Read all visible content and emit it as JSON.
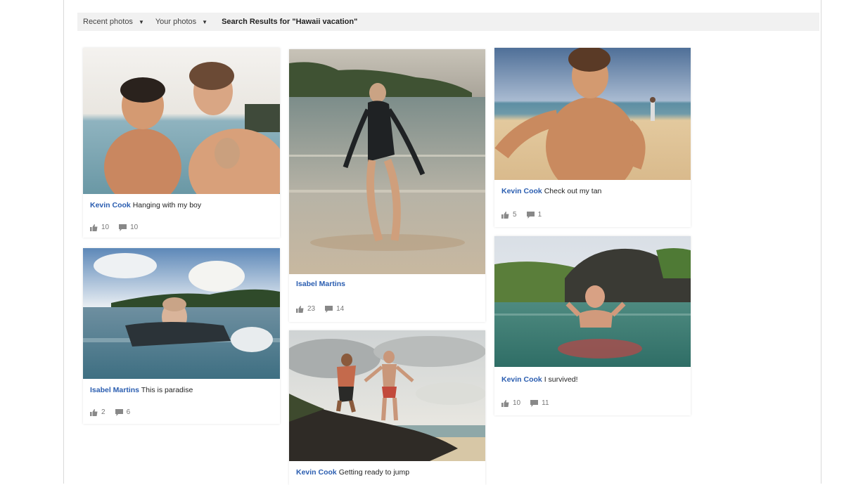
{
  "toolbar": {
    "recent_label": "Recent photos",
    "yours_label": "Your photos",
    "results_title": "Search Results for \"Hawaii vacation\""
  },
  "colors": {
    "author": "#2a5db0",
    "toolbar_bg": "#f1f1f1",
    "stat": "#777777"
  },
  "cards": [
    {
      "author": "Kevin Cook",
      "caption": "Hanging with my boy",
      "likes": "10",
      "comments": "10"
    },
    {
      "author": "Isabel Martins",
      "caption": "This is paradise",
      "likes": "2",
      "comments": "6"
    },
    {
      "author": "Isabel Martins",
      "caption": "",
      "likes": "23",
      "comments": "14"
    },
    {
      "author": "Kevin Cook",
      "caption": "Getting ready to jump",
      "likes": "",
      "comments": ""
    },
    {
      "author": "Kevin Cook",
      "caption": "Check out my tan",
      "likes": "5",
      "comments": "1"
    },
    {
      "author": "Kevin Cook",
      "caption": "I survived!",
      "likes": "10",
      "comments": "11"
    }
  ],
  "icons": {
    "like": "thumbs-up-icon",
    "comment": "comment-icon",
    "caret": "caret-down-icon"
  }
}
